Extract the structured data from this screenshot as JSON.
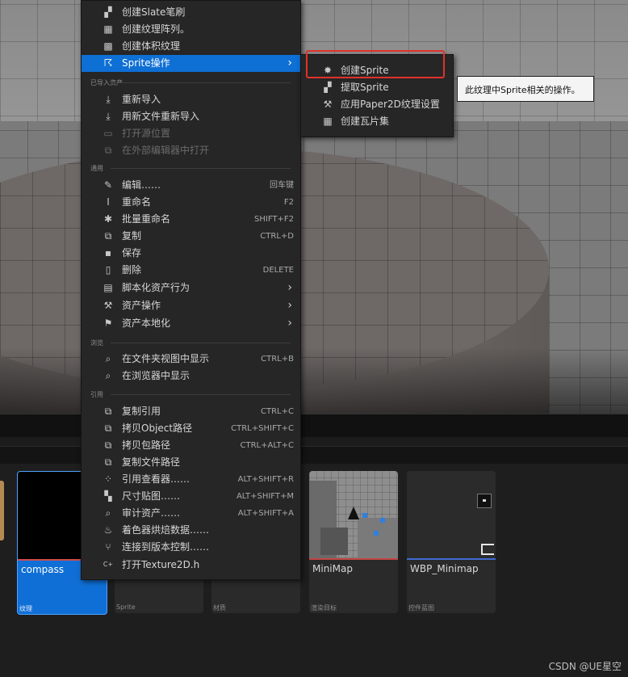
{
  "context_menu": {
    "items_top": [
      {
        "label": "创建Slate笔刷",
        "icon": "brush-icon"
      },
      {
        "label": "创建纹理阵列。",
        "icon": "texture-array-icon"
      },
      {
        "label": "创建体积纹理",
        "icon": "volume-texture-icon"
      },
      {
        "label": "Sprite操作",
        "icon": "sprite-run-icon",
        "submenu": true,
        "selected": true
      }
    ],
    "section_imported": "已导入资产",
    "items_imported": [
      {
        "label": "重新导入",
        "icon": "reimport-icon"
      },
      {
        "label": "用新文件重新导入",
        "icon": "reimport-new-file-icon"
      },
      {
        "label": "打开源位置",
        "icon": "open-source-folder-icon",
        "disabled": true
      },
      {
        "label": "在外部编辑器中打开",
        "icon": "external-editor-icon",
        "disabled": true
      }
    ],
    "section_common": "通用",
    "items_common": [
      {
        "label": "编辑……",
        "shortcut": "回车键",
        "icon": "pencil-icon"
      },
      {
        "label": "重命名",
        "shortcut": "F2",
        "icon": "rename-icon"
      },
      {
        "label": "批量重命名",
        "shortcut": "SHIFT+F2",
        "icon": "batch-rename-icon"
      },
      {
        "label": "复制",
        "shortcut": "CTRL+D",
        "icon": "duplicate-icon"
      },
      {
        "label": "保存",
        "shortcut": "",
        "icon": "save-icon"
      },
      {
        "label": "删除",
        "shortcut": "DELETE",
        "icon": "trash-icon"
      },
      {
        "label": "脚本化资产行为",
        "icon": "script-icon",
        "submenu": true
      },
      {
        "label": "资产操作",
        "icon": "wrench-icon",
        "submenu": true
      },
      {
        "label": "资产本地化",
        "icon": "flag-icon",
        "submenu": true
      }
    ],
    "section_browse": "浏览",
    "items_browse": [
      {
        "label": "在文件夹视图中显示",
        "shortcut": "CTRL+B",
        "icon": "folder-search-icon"
      },
      {
        "label": "在浏览器中显示",
        "shortcut": "",
        "icon": "browser-search-icon"
      }
    ],
    "section_reference": "引用",
    "items_reference": [
      {
        "label": "复制引用",
        "shortcut": "CTRL+C",
        "icon": "copy-reference-icon"
      },
      {
        "label": "拷贝Object路径",
        "shortcut": "CTRL+SHIFT+C",
        "icon": "copy-object-path-icon"
      },
      {
        "label": "拷贝包路径",
        "shortcut": "CTRL+ALT+C",
        "icon": "copy-package-path-icon"
      },
      {
        "label": "复制文件路径",
        "shortcut": "",
        "icon": "copy-file-path-icon"
      },
      {
        "label": "引用查看器……",
        "shortcut": "ALT+SHIFT+R",
        "icon": "reference-viewer-icon"
      },
      {
        "label": "尺寸贴图……",
        "shortcut": "ALT+SHIFT+M",
        "icon": "size-map-icon"
      },
      {
        "label": "审计资产……",
        "shortcut": "ALT+SHIFT+A",
        "icon": "audit-icon"
      },
      {
        "label": "着色器烘焙数据……",
        "shortcut": "",
        "icon": "shader-cook-icon"
      },
      {
        "label": "连接到版本控制……",
        "shortcut": "",
        "icon": "source-control-icon"
      },
      {
        "label": "打开Texture2D.h",
        "shortcut": "",
        "icon": "cpp-header-icon"
      }
    ]
  },
  "submenu": {
    "items": [
      {
        "label": "创建Sprite",
        "icon": "create-sprite-icon"
      },
      {
        "label": "提取Sprite",
        "icon": "extract-sprite-icon"
      },
      {
        "label": "应用Paper2D纹理设置",
        "icon": "paper2d-settings-icon"
      },
      {
        "label": "创建瓦片集",
        "icon": "tileset-icon"
      }
    ]
  },
  "tooltip": "此纹理中Sprite相关的操作。",
  "assets": [
    {
      "name": "compass",
      "type": "纹理"
    },
    {
      "name": "",
      "type": "Sprite"
    },
    {
      "name": "",
      "type": "材质"
    },
    {
      "name": "MiniMap",
      "type": "渲染目标"
    },
    {
      "name": "WBP_Minimap",
      "type": "控件蓝图"
    }
  ],
  "watermark": "CSDN @UE星空",
  "colors": {
    "selection": "#0e6fd4",
    "highlight_box": "#e0312b",
    "menu_bg": "#262626"
  }
}
